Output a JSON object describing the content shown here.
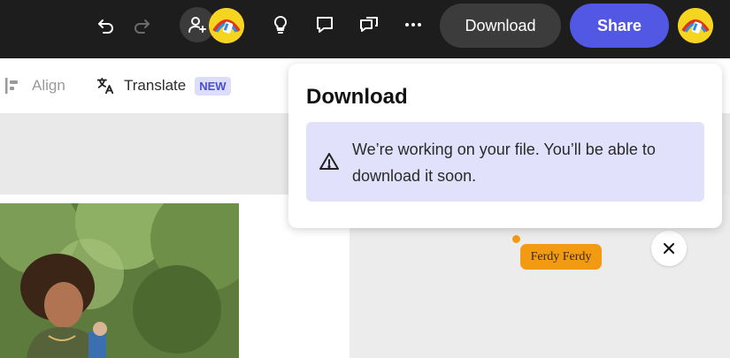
{
  "topbar": {
    "download_label": "Download",
    "share_label": "Share",
    "icons": [
      "undo-icon",
      "redo-icon",
      "invite-icon",
      "lightbulb-icon",
      "comment-icon",
      "chat-icon",
      "more-icon"
    ]
  },
  "toolbar": {
    "align_label": "Align",
    "translate_label": "Translate",
    "new_badge": "NEW"
  },
  "popover": {
    "title": "Download",
    "message": "We’re working on your file. You’ll be able to download it soon."
  },
  "canvas": {
    "tag_label": "Ferdy Ferdy"
  },
  "colors": {
    "topbar_bg": "#1d1d1d",
    "share_bg": "#5258e4",
    "alert_bg": "#e1e1fb",
    "tag_bg": "#f29a12"
  }
}
